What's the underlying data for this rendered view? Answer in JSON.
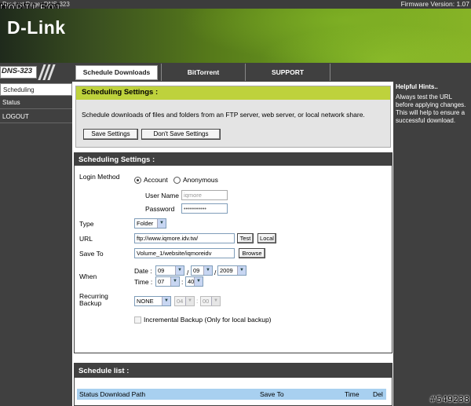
{
  "watermark": {
    "brand": "MOBILE",
    "num": "01"
  },
  "topbar": {
    "product": "Product Page: DNS-323",
    "firmware": "Firmware Version: 1.07"
  },
  "brand": {
    "logo": "D-Link"
  },
  "model": "DNS-323",
  "nav": {
    "tabs": [
      "Schedule Downloads",
      "BitTorrent",
      "SUPPORT"
    ]
  },
  "sidebar": {
    "items": [
      "Scheduling",
      "Status",
      "LOGOUT"
    ]
  },
  "hints": {
    "title": "Helpful Hints..",
    "text": "Always test the URL before applying changes. This will help to ensure a successful download."
  },
  "settings_box": {
    "title": "Scheduling Settings :",
    "description": "Schedule downloads of files and folders from an FTP server, web server, or local network share.",
    "save_label": "Save Settings",
    "dont_save_label": "Don't Save Settings"
  },
  "form": {
    "title": "Scheduling Settings :",
    "login_method_label": "Login Method",
    "login_options": [
      "Account",
      "Anonymous"
    ],
    "selected_login": "Account",
    "username_label": "User Name",
    "username_value": "iqmore",
    "password_label": "Password",
    "password_value": "•••••••••••",
    "type_label": "Type",
    "type_value": "Folder",
    "url_label": "URL",
    "url_value": "ftp://www.iqmore.idv.tw/",
    "test_label": "Test",
    "local_label": "Local",
    "saveto_label": "Save To",
    "saveto_value": "Volume_1/website/iqmoreidv",
    "browse_label": "Browse",
    "when_label": "When",
    "date_label": "Date :",
    "date_month": "09",
    "date_day": "09",
    "date_year": "2009",
    "date_sep1": "/",
    "date_sep2": "/",
    "time_label": "Time :",
    "time_hour": "07",
    "time_sep": ":",
    "time_min": "40",
    "recurring_label": "Recurring Backup",
    "recurring_value": "NONE",
    "recurring_hour": "04",
    "recurring_sep": ":",
    "recurring_min": "00",
    "incremental_label": "Incremental Backup (Only for local backup)"
  },
  "schedule_list": {
    "title": "Schedule list :",
    "columns": [
      "Status Download Path",
      "Save To",
      "Time",
      "Del"
    ]
  },
  "corner_tag": "#549238"
}
